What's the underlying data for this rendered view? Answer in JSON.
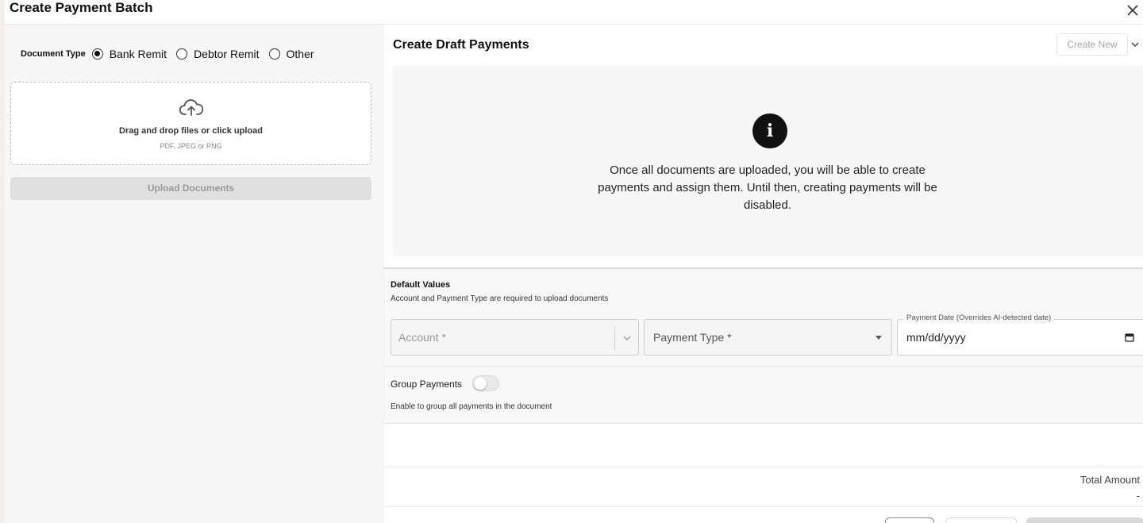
{
  "header": {
    "title": "Create Payment Batch"
  },
  "left": {
    "document_type_label": "Document Type",
    "document_types": [
      {
        "label": "Bank Remit",
        "selected": true
      },
      {
        "label": "Debtor Remit",
        "selected": false
      },
      {
        "label": "Other",
        "selected": false
      }
    ],
    "dropzone": {
      "title": "Drag and drop files or click upload",
      "subtitle": "PDF, JPEG or PNG"
    },
    "upload_button": "Upload Documents"
  },
  "right": {
    "title": "Create Draft Payments",
    "create_new_label": "Create New",
    "info_message": "Once all documents are uploaded, you will be able to create payments and assign them. Until then, creating payments will be disabled.",
    "defaults": {
      "title": "Default Values",
      "subtitle": "Account and Payment Type are required to upload documents",
      "account_placeholder": "Account *",
      "payment_type_placeholder": "Payment Type *",
      "payment_date_label": "Payment Date (Overrides AI-detected date)",
      "payment_date_value": "mm/dd/yyyy",
      "group_payments_label": "Group Payments",
      "group_payments_enabled": false,
      "group_payments_hint": "Enable to group all payments in the document"
    },
    "total_amount_label": "Total Amount",
    "total_amount_value": "-"
  },
  "colors": {
    "selected_radio": "#111111",
    "disabled_button": "#e0e0e0"
  }
}
